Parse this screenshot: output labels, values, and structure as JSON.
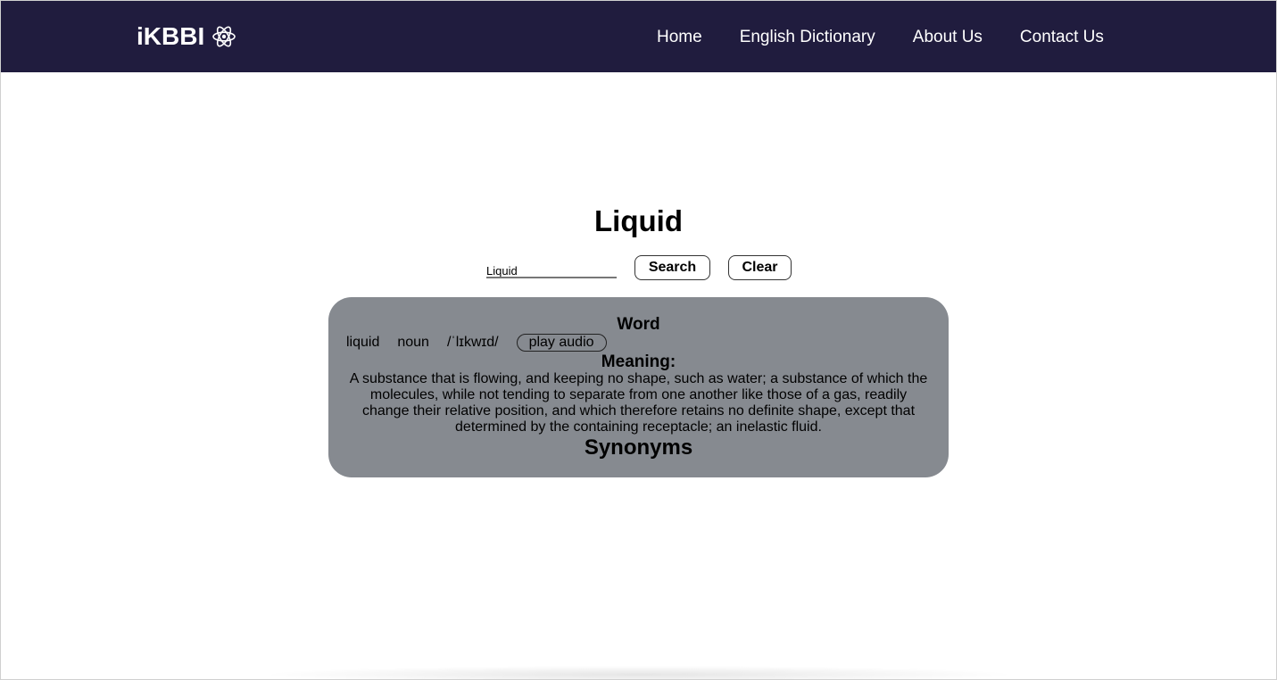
{
  "header": {
    "brand": "iKBBI",
    "brand_icon": "atom-icon",
    "nav": [
      "Home",
      "English Dictionary",
      "About Us",
      "Contact Us"
    ]
  },
  "main": {
    "title": "Liquid",
    "search": {
      "value": "Liquid"
    },
    "search_button": "Search",
    "clear_button": "Clear"
  },
  "result": {
    "word_heading": "Word",
    "word": "liquid",
    "part_of_speech": "noun",
    "phonetic": "/ˈlɪkwɪd/",
    "play_audio": "play audio",
    "meaning_heading": "Meaning:",
    "definition": "A substance that is flowing, and keeping no shape, such as water; a substance of which the molecules, while not tending to separate from one another like those of a gas, readily change their relative position, and which therefore retains no definite shape, except that determined by the containing receptacle; an inelastic fluid.",
    "synonyms_heading": "Synonyms"
  },
  "colors": {
    "navbar": "#201c3e",
    "card": "#868a90"
  }
}
